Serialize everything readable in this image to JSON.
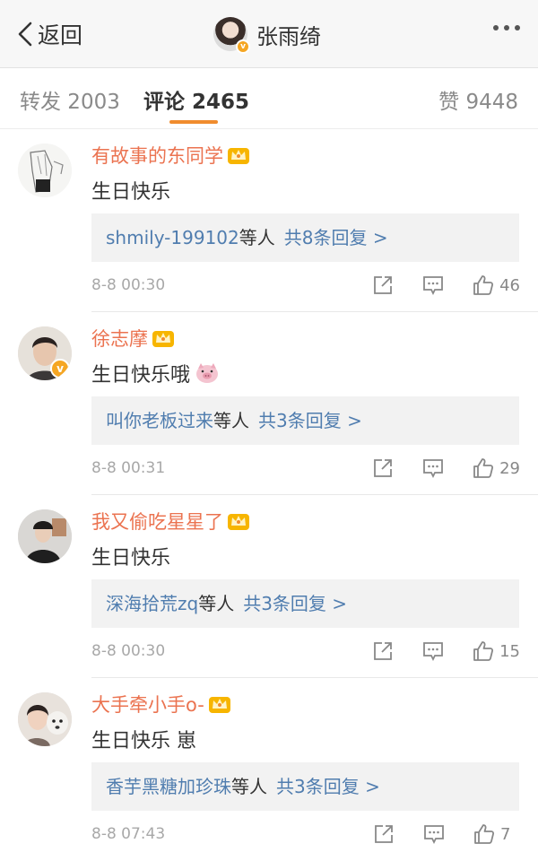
{
  "nav": {
    "back_label": "返回",
    "title": "张雨绮"
  },
  "tabs": {
    "repost": "转发 2003",
    "comment": "评论 2465",
    "like": "赞 9448"
  },
  "colors": {
    "username": "#eb7350",
    "link": "#507daf",
    "tab_underline": "#f08c2e",
    "verified_badge": "#f5a623"
  },
  "comments": [
    {
      "username": "有故事的东同学",
      "text": "生日快乐",
      "reply_names": "shmily-199102",
      "reply_suffix": "等人",
      "reply_count": "共8条回复 >",
      "time": "8-8 00:30",
      "likes": "46",
      "verified": false,
      "emoji": null
    },
    {
      "username": "徐志摩",
      "text": "生日快乐哦",
      "reply_names": "叫你老板过来",
      "reply_suffix": "等人",
      "reply_count": "共3条回复 >",
      "time": "8-8 00:31",
      "likes": "29",
      "verified": true,
      "emoji": "pig-emoji"
    },
    {
      "username": "我又偷吃星星了",
      "text": "生日快乐",
      "reply_names": "深海拾荒zq",
      "reply_suffix": "等人",
      "reply_count": "共3条回复 >",
      "time": "8-8 00:30",
      "likes": "15",
      "verified": false,
      "emoji": null
    },
    {
      "username": "大手牵小手o-",
      "text": "生日快乐 崽",
      "reply_names": "香芋黑糖加珍珠",
      "reply_suffix": "等人",
      "reply_count": "共3条回复 >",
      "time": "8-8 07:43",
      "likes": "7",
      "verified": false,
      "emoji": null
    }
  ]
}
